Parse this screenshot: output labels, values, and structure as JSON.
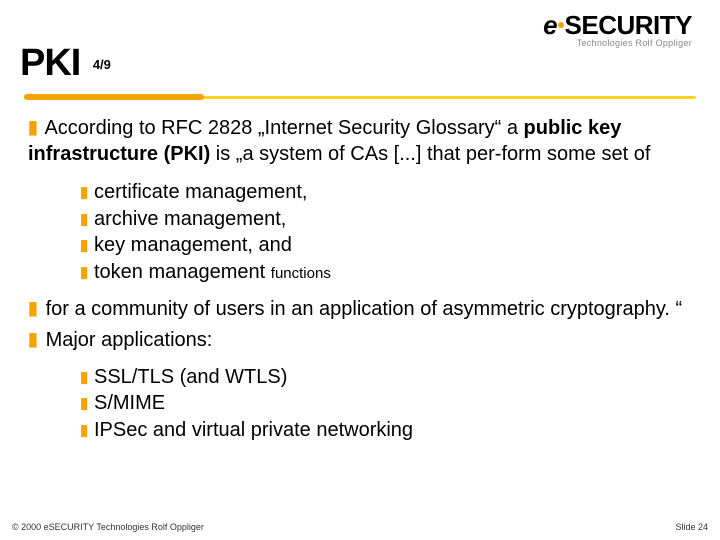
{
  "logo": {
    "e": "e",
    "dot": "•",
    "sec": "SECURITY",
    "sub": "Technologies Rolf Oppliger"
  },
  "title": {
    "main": "PKI",
    "frac": "4/9"
  },
  "para1": {
    "lead": "According to RFC 2828 „Internet Security Glossary“ a ",
    "bold": "public key infrastructure (PKI)",
    "tail": " is „a system of CAs [...] that per-form some set of"
  },
  "list1": {
    "i0": "certificate management,",
    "i1": "archive management,",
    "i2": "key management, and",
    "i3a": "token management ",
    "i3b": "functions"
  },
  "para2": "for a community of users in an application of asymmetric cryptography. “",
  "para3": "Major applications:",
  "list2": {
    "i0": "SSL/TLS (and WTLS)",
    "i1": "S/MIME",
    "i2": "IPSec and virtual private networking"
  },
  "footer": {
    "left": "© 2000 eSECURITY Technologies Rolf Oppliger",
    "right": "Slide  24"
  }
}
